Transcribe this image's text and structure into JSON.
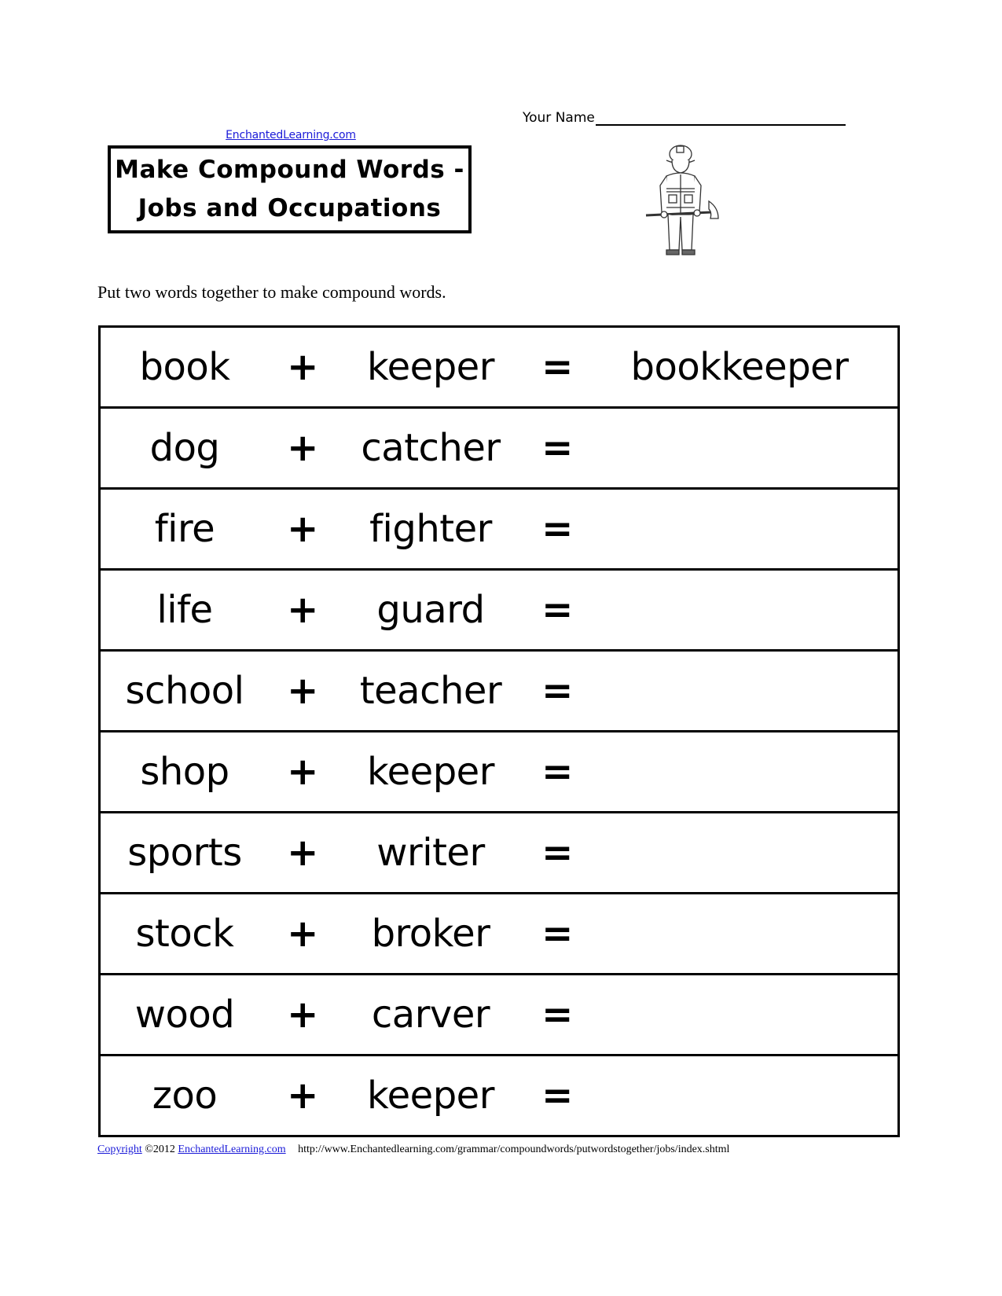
{
  "header": {
    "site_link": "EnchantedLearning.com",
    "title_line1": "Make Compound Words -",
    "title_line2": "Jobs and Occupations",
    "name_label": "Your Name",
    "illustration": "firefighter-with-axe-icon"
  },
  "instructions": "Put two words together to make compound words.",
  "table": {
    "plus_symbol": "+",
    "equals_symbol": "=",
    "rows": [
      {
        "first": "book",
        "second": "keeper",
        "answer": "bookkeeper"
      },
      {
        "first": "dog",
        "second": "catcher",
        "answer": ""
      },
      {
        "first": "fire",
        "second": "fighter",
        "answer": ""
      },
      {
        "first": "life",
        "second": "guard",
        "answer": ""
      },
      {
        "first": "school",
        "second": "teacher",
        "answer": ""
      },
      {
        "first": "shop",
        "second": "keeper",
        "answer": ""
      },
      {
        "first": "sports",
        "second": "writer",
        "answer": ""
      },
      {
        "first": "stock",
        "second": "broker",
        "answer": ""
      },
      {
        "first": "wood",
        "second": "carver",
        "answer": ""
      },
      {
        "first": "zoo",
        "second": "keeper",
        "answer": ""
      }
    ]
  },
  "footer": {
    "copyright_link": "Copyright",
    "year_text": "©2012",
    "site_link": "EnchantedLearning.com",
    "url_text": "http://www.Enchantedlearning.com/grammar/compoundwords/putwordstogether/jobs/index.shtml"
  },
  "colors": {
    "link": "#1a1ad8",
    "text": "#000000"
  }
}
